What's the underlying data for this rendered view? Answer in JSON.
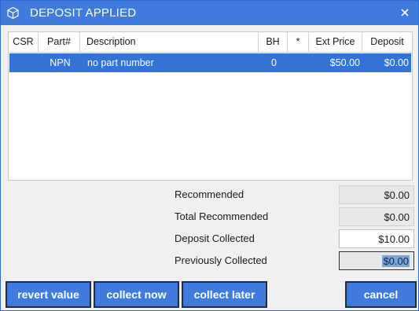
{
  "window": {
    "title": "DEPOSIT APPLIED",
    "title_icon": "cube-icon",
    "close_icon": "close-icon"
  },
  "grid": {
    "columns": {
      "csr": "CSR",
      "part": "Part#",
      "description": "Description",
      "bh": "BH",
      "star": "*",
      "ext_price": "Ext Price",
      "deposit": "Deposit"
    },
    "rows": [
      {
        "csr": "",
        "part": "NPN",
        "description": "no part number",
        "bh": "0",
        "star": "",
        "ext_price": "$50.00",
        "deposit": "$0.00",
        "selected": true
      }
    ]
  },
  "summary": {
    "recommended": {
      "label": "Recommended",
      "value": "$0.00"
    },
    "total_recommended": {
      "label": "Total Recommended",
      "value": "$0.00"
    },
    "deposit_collected": {
      "label": "Deposit Collected",
      "value": "$10.00"
    },
    "previously_collected": {
      "label": "Previously Collected",
      "value": "$0.00"
    }
  },
  "buttons": {
    "revert": "revert value",
    "collect_now": "collect now",
    "collect_later": "collect later",
    "cancel": "cancel"
  },
  "colors": {
    "accent": "#3f7bdc",
    "selection": "#3372d6",
    "button_border": "#1c2d52"
  }
}
